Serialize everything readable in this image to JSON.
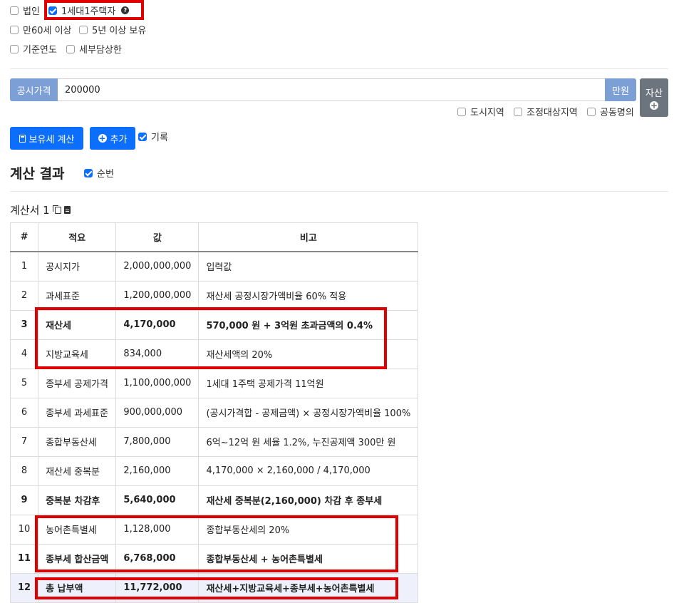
{
  "options": {
    "corporate": {
      "label": "법인",
      "checked": false
    },
    "one_house": {
      "label": "1세대1주택자",
      "checked": true
    },
    "age60": {
      "label": "만60세 이상",
      "checked": false
    },
    "hold5": {
      "label": "5년 이상 보유",
      "checked": false
    },
    "base_year": {
      "label": "기준연도",
      "checked": false
    },
    "tax_limit": {
      "label": "세부담상한",
      "checked": false
    }
  },
  "price_input": {
    "label": "공시가격",
    "value": "200000",
    "unit": "만원"
  },
  "asset_button": {
    "label": "자산"
  },
  "region_options": {
    "city": {
      "label": "도시지역",
      "checked": false
    },
    "adjusted": {
      "label": "조정대상지역",
      "checked": false
    },
    "joint": {
      "label": "공동명의",
      "checked": false
    }
  },
  "actions": {
    "calc_label": "보유세 계산",
    "add_label": "추가",
    "record": {
      "label": "기록",
      "checked": true
    }
  },
  "result": {
    "title": "계산 결과",
    "order": {
      "label": "순번",
      "checked": true
    },
    "doc_title": "계산서 1"
  },
  "table": {
    "headers": [
      "#",
      "적요",
      "값",
      "비고"
    ],
    "rows": [
      {
        "no": "1",
        "item": "공시지가",
        "value": "2,000,000,000",
        "note": "입력값"
      },
      {
        "no": "2",
        "item": "과세표준",
        "value": "1,200,000,000",
        "note": "재산세 공정시장가액비율 60% 적용"
      },
      {
        "no": "3",
        "item": "재산세",
        "value": "4,170,000",
        "note": "570,000 원 + 3억원 초과금액의 0.4%"
      },
      {
        "no": "4",
        "item": "지방교육세",
        "value": "834,000",
        "note": "재산세액의 20%"
      },
      {
        "no": "5",
        "item": "종부세 공제가격",
        "value": "1,100,000,000",
        "note": "1세대 1주택 공제가격 11억원"
      },
      {
        "no": "6",
        "item": "종부세 과세표준",
        "value": "900,000,000",
        "note": "(공시가격합 - 공제금액) × 공정시장가액비율 100%"
      },
      {
        "no": "7",
        "item": "종합부동산세",
        "value": "7,800,000",
        "note": "6억~12억 원 세율 1.2%, 누진공제액 300만 원"
      },
      {
        "no": "8",
        "item": "재산세 중복분",
        "value": "2,160,000",
        "note": "4,170,000 × 2,160,000 / 4,170,000"
      },
      {
        "no": "9",
        "item": "중복분 차감후",
        "value": "5,640,000",
        "note": "재산세 중복분(2,160,000) 차감 후 종부세"
      },
      {
        "no": "10",
        "item": "농어촌특별세",
        "value": "1,128,000",
        "note": "종합부동산세의 20%"
      },
      {
        "no": "11",
        "item": "종부세 합산금액",
        "value": "6,768,000",
        "note": "종합부동산세 + 농어촌특별세"
      },
      {
        "no": "12",
        "item": "총 납부액",
        "value": "11,772,000",
        "note": "재산세+지방교육세+종부세+농어촌특별세"
      }
    ]
  }
}
